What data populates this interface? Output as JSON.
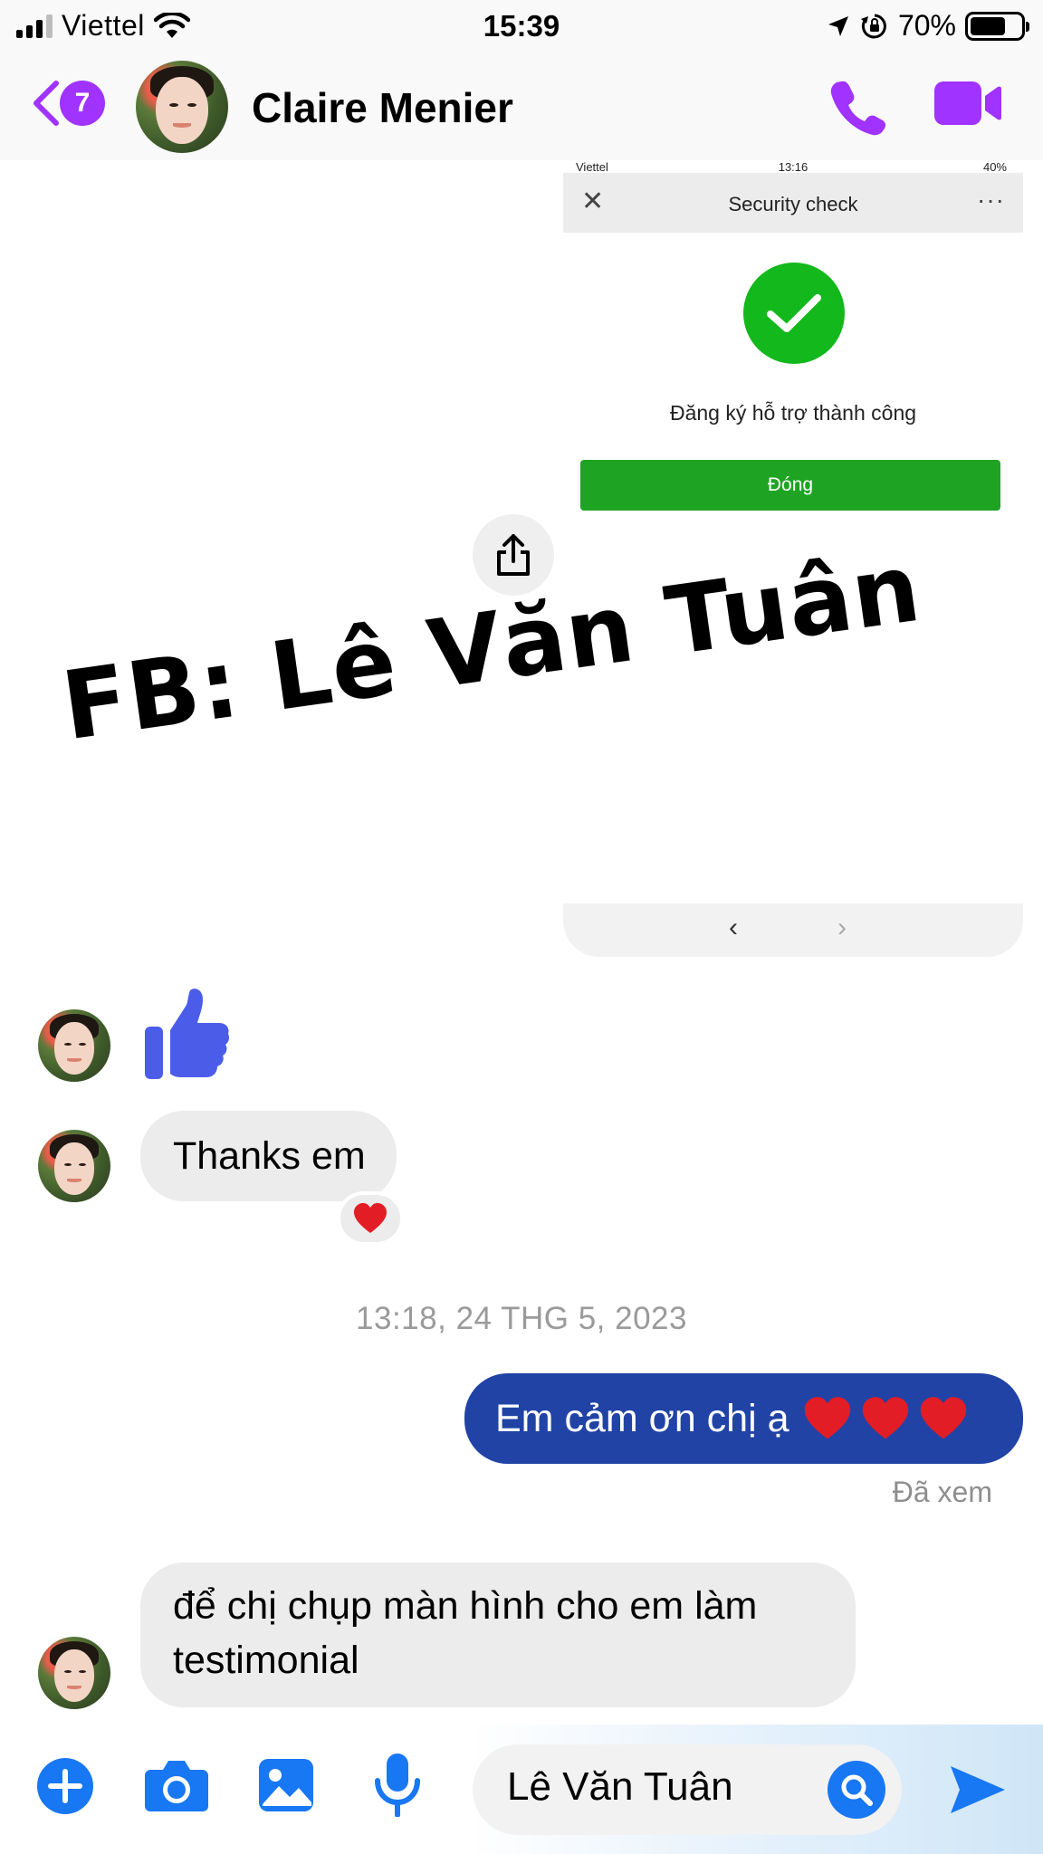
{
  "status_bar": {
    "carrier": "Viettel",
    "time": "15:39",
    "battery_percent": "70%"
  },
  "header": {
    "unread_count": "7",
    "contact_name": "Claire Menier"
  },
  "shared_screenshot": {
    "status_carrier": "Viettel",
    "status_time": "13:16",
    "status_battery": "40%",
    "title": "Security check",
    "message": "Đăng ký hỗ trợ thành công",
    "button_label": "Đóng"
  },
  "watermark": "FB: Lê Văn Tuân",
  "messages": {
    "thanks": "Thanks em",
    "timestamp": "13:18, 24 THG 5, 2023",
    "outgoing": "Em cảm ơn chị ạ",
    "seen": "Đã xem",
    "incoming_last_line1": "để chị chụp màn hình cho em làm",
    "incoming_last_line2": "testimonial"
  },
  "composer": {
    "input_value": "Lê Văn Tuân"
  },
  "colors": {
    "accent_purple": "#a033ff",
    "outgoing_bubble": "#2143a6",
    "composer_blue": "#1877f2",
    "thumb_blue": "#4b5de8",
    "success_green": "#12b81c"
  },
  "icons": [
    "signal-icon",
    "wifi-icon",
    "location-icon",
    "rotation-lock-icon",
    "battery-icon",
    "chevron-left-icon",
    "phone-icon",
    "video-camera-icon",
    "close-icon",
    "more-icon",
    "checkmark-icon",
    "share-icon",
    "thumbs-up-icon",
    "heart-icon",
    "plus-icon",
    "camera-icon",
    "image-icon",
    "microphone-icon",
    "search-icon",
    "send-icon"
  ]
}
